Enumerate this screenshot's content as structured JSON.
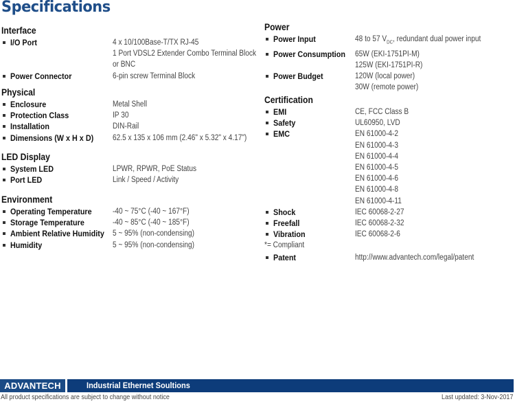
{
  "page": {
    "title": "Specifications",
    "brand_color": "#1f4e89"
  },
  "left": {
    "sections": [
      {
        "title": "Interface",
        "rows": [
          {
            "label": "I/O Port",
            "values": [
              "4 x 10/100Base-T/TX RJ-45",
              "1 Port VDSL2 Extender Combo Terminal Block",
              "or BNC"
            ]
          },
          {
            "label": "Power Connector",
            "values": [
              "6-pin screw Terminal Block"
            ]
          }
        ]
      },
      {
        "title": "Physical",
        "rows": [
          {
            "label": "Enclosure",
            "values": [
              "Metal Shell"
            ]
          },
          {
            "label": "Protection Class",
            "values": [
              "IP 30"
            ]
          },
          {
            "label": "Installation",
            "values": [
              "DIN-Rail"
            ]
          },
          {
            "label": "Dimensions (W x H x D)",
            "values": [
              "62.5 x 135 x 106 mm (2.46\" x 5.32\" x 4.17\")"
            ]
          }
        ]
      },
      {
        "title": "LED Display",
        "rows": [
          {
            "label": "System LED",
            "values": [
              "LPWR, RPWR, PoE Status"
            ]
          },
          {
            "label": "Port LED",
            "values": [
              "Link / Speed / Activity"
            ]
          }
        ]
      },
      {
        "title": "Environment",
        "rows": [
          {
            "label": "Operating Temperature",
            "values": [
              "-40 ~ 75°C (-40 ~ 167°F)"
            ]
          },
          {
            "label": "Storage Temperature",
            "values": [
              "-40 ~ 85°C (-40 ~ 185°F)"
            ]
          },
          {
            "label": "Ambient Relative Humidity",
            "values": [
              "5 ~ 95% (non-condensing)"
            ]
          },
          {
            "label": "Humidity",
            "values": [
              "5 ~ 95% (non-condensing)"
            ]
          }
        ]
      }
    ]
  },
  "right": {
    "sections": [
      {
        "title": "Power",
        "rows": [
          {
            "label": "Power Input",
            "values": [
              "48 to 57 V",
              "DC",
              ", redundant dual power input"
            ]
          },
          {
            "label": "Power Consumption",
            "values": [
              "65W (EKI-1751PI-M)",
              "125W (EKI-1751PI-R)"
            ]
          },
          {
            "label": "Power Budget",
            "values": [
              "120W (local power)",
              "30W (remote power)"
            ]
          }
        ]
      },
      {
        "title": "Certification",
        "rows": [
          {
            "label": "EMI",
            "values": [
              "CE, FCC Class B"
            ]
          },
          {
            "label": "Safety",
            "values": [
              "UL60950, LVD"
            ]
          },
          {
            "label": "EMC",
            "values": [
              "EN 61000-4-2",
              "EN 61000-4-3",
              "EN 61000-4-4",
              "EN 61000-4-5",
              "EN 61000-4-6",
              "EN 61000-4-8",
              "EN 61000-4-11"
            ]
          },
          {
            "label": "Shock",
            "values": [
              "IEC 60068-2-27"
            ]
          },
          {
            "label": "Freefall",
            "values": [
              "IEC 60068-2-32"
            ]
          },
          {
            "label": "Vibration",
            "values": [
              "IEC 60068-2-6"
            ]
          }
        ],
        "note": "*= Compliant",
        "patent": {
          "label": "Patent",
          "value": "http://www.advantech.com/legal/patent"
        }
      }
    ]
  },
  "footer": {
    "logo": "ADVANTECH",
    "tagline": "Industrial Ethernet Soultions",
    "disclaimer": "All product specifications are subject to change without notice",
    "last_updated": "Last updated: 3-Nov-2017"
  }
}
